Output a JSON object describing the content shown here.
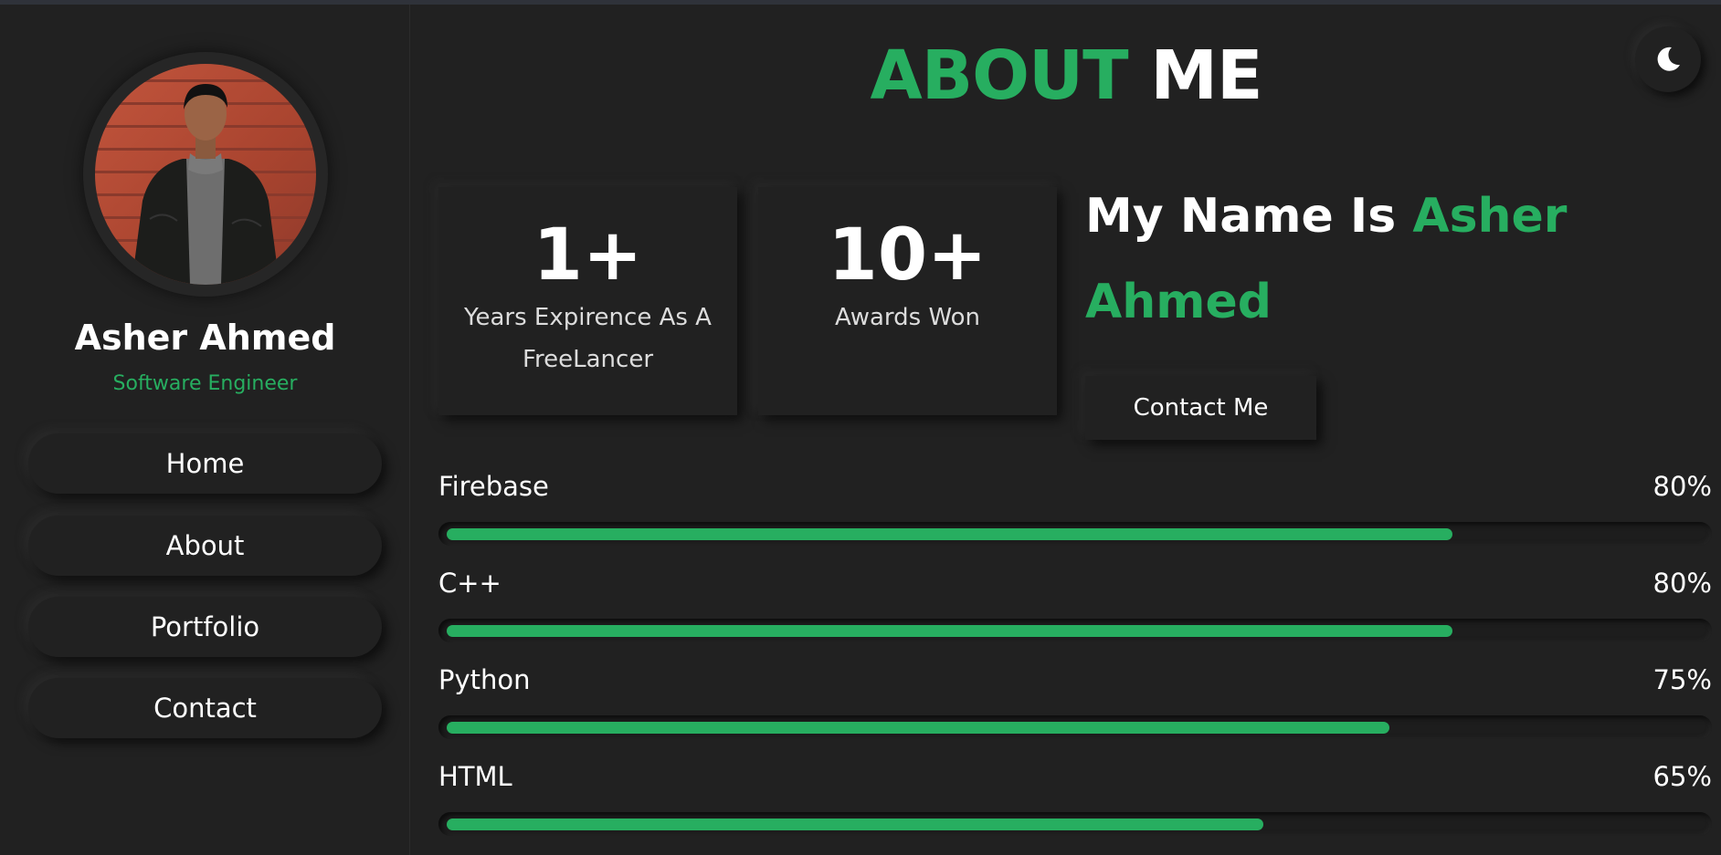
{
  "colors": {
    "accent": "#27ae60",
    "background": "#212121",
    "text": "#ffffff"
  },
  "profile": {
    "name": "Asher Ahmed",
    "role": "Software Engineer",
    "avatar_icon": "profile-photo"
  },
  "nav": [
    {
      "label": "Home"
    },
    {
      "label": "About"
    },
    {
      "label": "Portfolio"
    },
    {
      "label": "Contact"
    }
  ],
  "header": {
    "title_accent": "ABOUT",
    "title_rest": "ME",
    "theme_toggle_icon": "moon-icon"
  },
  "stats": [
    {
      "value": "1+",
      "label": "Years Expirence As A FreeLancer"
    },
    {
      "value": "10+",
      "label": "Awards Won"
    }
  ],
  "intro": {
    "prefix": "My Name Is",
    "first_name": "Asher",
    "last_name": "Ahmed"
  },
  "contact_button": {
    "label": "Contact Me"
  },
  "skills": [
    {
      "name": "Firebase",
      "percent_label": "80%",
      "percent": 80
    },
    {
      "name": "C++",
      "percent_label": "80%",
      "percent": 80
    },
    {
      "name": "Python",
      "percent_label": "75%",
      "percent": 75
    },
    {
      "name": "HTML",
      "percent_label": "65%",
      "percent": 65
    }
  ]
}
